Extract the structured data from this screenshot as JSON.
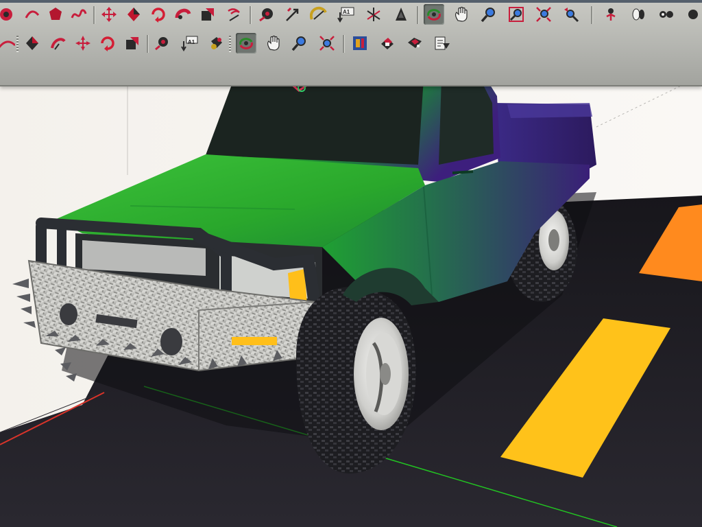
{
  "app": {
    "name": ""
  },
  "toolbars": {
    "row1": [
      {
        "name": "arc-tool-icon"
      },
      {
        "name": "arc-tool-icon"
      },
      {
        "name": "polygon-tool-icon"
      },
      {
        "name": "freehand-tool-icon"
      },
      {
        "name": "move-tool-icon"
      },
      {
        "name": "push-pull-tool-icon"
      },
      {
        "name": "rotate-tool-icon"
      },
      {
        "name": "follow-me-tool-icon"
      },
      {
        "name": "scale-tool-icon"
      },
      {
        "name": "offset-tool-icon"
      },
      {
        "name": "tape-measure-tool-icon"
      },
      {
        "name": "dimension-tool-icon"
      },
      {
        "name": "protractor-tool-icon"
      },
      {
        "name": "text-tool-icon",
        "label": "A1"
      },
      {
        "name": "axes-tool-icon"
      },
      {
        "name": "3d-text-tool-icon"
      },
      {
        "name": "orbit-tool-icon",
        "active": true
      },
      {
        "name": "pan-tool-icon"
      },
      {
        "name": "zoom-tool-icon"
      },
      {
        "name": "zoom-window-icon"
      },
      {
        "name": "zoom-extents-icon"
      },
      {
        "name": "previous-view-icon"
      },
      {
        "name": "position-camera-icon"
      },
      {
        "name": "walk-tool-icon"
      },
      {
        "name": "look-around-icon"
      }
    ],
    "row2": [
      {
        "name": "arc-tool-icon"
      },
      {
        "name": "move-tool-icon"
      },
      {
        "name": "push-pull-tool-icon"
      },
      {
        "name": "rotate-tool-icon"
      },
      {
        "name": "follow-me-tool-icon"
      },
      {
        "name": "scale-tool-icon"
      },
      {
        "name": "offset-tool-icon"
      },
      {
        "name": "tape-measure-tool-icon"
      },
      {
        "name": "text-tool-icon",
        "label": "A1"
      },
      {
        "name": "paint-bucket-icon"
      },
      {
        "name": "orbit-tool-icon",
        "active": true
      },
      {
        "name": "pan-tool-icon"
      },
      {
        "name": "zoom-tool-icon"
      },
      {
        "name": "zoom-extents-icon"
      },
      {
        "name": "get-models-icon"
      },
      {
        "name": "share-model-icon"
      },
      {
        "name": "get-components-icon"
      },
      {
        "name": "send-to-layout-icon"
      }
    ]
  },
  "colors": {
    "toolbar_bg": "#b8b9b4",
    "truck_body": "#2fb12f",
    "truck_shadow": "#4b1f8a",
    "ground": "#232228",
    "road_marking_yellow": "#ffc21a",
    "road_marking_orange": "#ff8a1e",
    "axis_red": "#d9342a",
    "axis_green": "#22c322",
    "sky": "#f5f3ef"
  },
  "scene": {
    "model": "pickup-truck"
  }
}
